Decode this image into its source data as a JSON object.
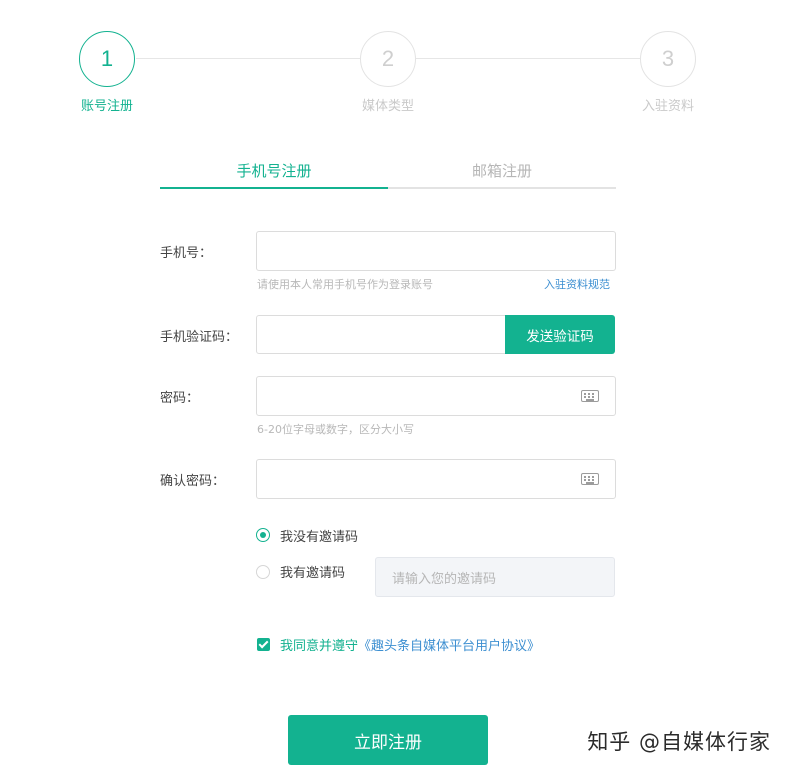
{
  "steps": [
    {
      "num": "1",
      "label": "账号注册"
    },
    {
      "num": "2",
      "label": "媒体类型"
    },
    {
      "num": "3",
      "label": "入驻资料"
    }
  ],
  "tabs": {
    "phone": "手机号注册",
    "email": "邮箱注册"
  },
  "form": {
    "phone_label": "手机号：",
    "phone_hint": "请使用本人常用手机号作为登录账号",
    "rules_link": "入驻资料规范",
    "code_label": "手机验证码：",
    "send_code": "发送验证码",
    "password_label": "密码：",
    "password_hint": "6-20位字母或数字，区分大小写",
    "confirm_label": "确认密码："
  },
  "invite": {
    "no_code": "我没有邀请码",
    "has_code": "我有邀请码",
    "placeholder": "请输入您的邀请码"
  },
  "agreement": {
    "prefix": "我同意并遵守",
    "link": "《趣头条自媒体平台用户协议》"
  },
  "submit": "立即注册",
  "watermark": "知乎 @自媒体行家",
  "colors": {
    "accent": "#13b290",
    "link": "#3d8fd1"
  }
}
